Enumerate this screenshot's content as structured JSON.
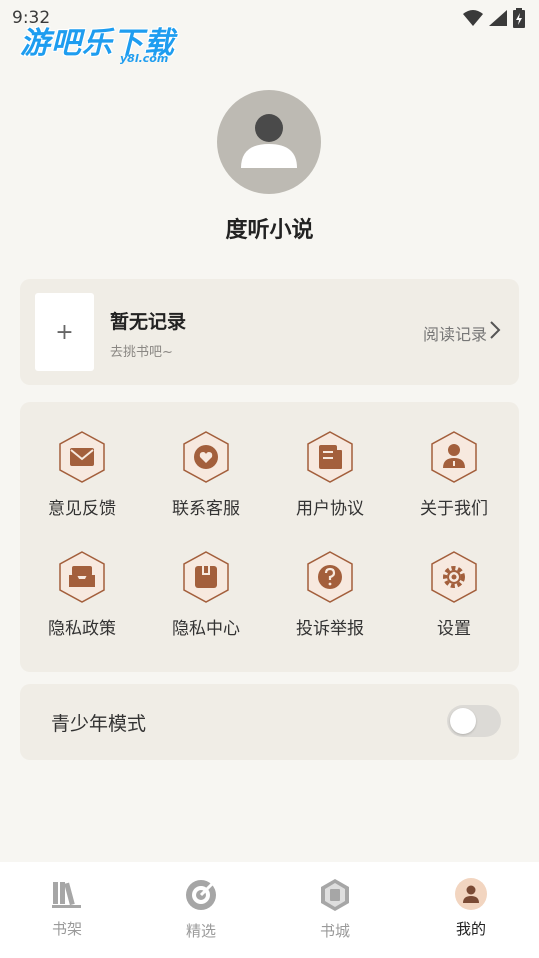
{
  "status": {
    "time": "9:32"
  },
  "watermark": {
    "main": "游吧乐下载",
    "sub": "y8l.com"
  },
  "profile": {
    "name": "度听小说"
  },
  "history": {
    "thumb_symbol": "+",
    "title": "暂无记录",
    "subtitle": "去挑书吧~",
    "link_label": "阅读记录"
  },
  "menu": {
    "items": [
      {
        "label": "意见反馈",
        "icon": "envelope-icon"
      },
      {
        "label": "联系客服",
        "icon": "chat-heart-icon"
      },
      {
        "label": "用户协议",
        "icon": "document-icon"
      },
      {
        "label": "关于我们",
        "icon": "person-icon"
      },
      {
        "label": "隐私政策",
        "icon": "inbox-icon"
      },
      {
        "label": "隐私中心",
        "icon": "box-icon"
      },
      {
        "label": "投诉举报",
        "icon": "question-icon"
      },
      {
        "label": "设置",
        "icon": "gear-icon"
      }
    ]
  },
  "teen_mode": {
    "label": "青少年模式",
    "enabled": false
  },
  "tabs": [
    {
      "label": "书架",
      "icon": "bookshelf-icon",
      "active": false
    },
    {
      "label": "精选",
      "icon": "target-icon",
      "active": false
    },
    {
      "label": "书城",
      "icon": "bookstore-icon",
      "active": false
    },
    {
      "label": "我的",
      "icon": "profile-icon",
      "active": true
    }
  ],
  "colors": {
    "accent": "#a35f3c",
    "icon_fill": "#f7e9df",
    "card_bg": "#f0ede6",
    "page_bg": "#f7f6f2"
  }
}
